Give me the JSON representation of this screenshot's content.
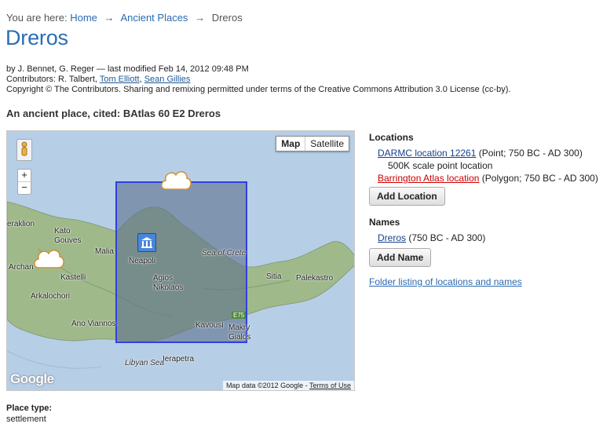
{
  "breadcrumb": {
    "prefix": "You are here:",
    "items": [
      "Home",
      "Ancient Places",
      "Dreros"
    ]
  },
  "page_title": "Dreros",
  "meta": {
    "byline": "by J. Bennet, G. Reger — last modified Feb 14, 2012 09:48 PM",
    "contributors_prefix": "Contributors: R. Talbert,",
    "contributor_links": [
      "Tom Elliott",
      "Sean Gillies"
    ],
    "copyright": "Copyright © The Contributors. Sharing and remixing permitted under terms of the Creative Commons Attribution 3.0 License (cc-by)."
  },
  "subtitle": "An ancient place, cited: BAtlas 60 E2 Dreros",
  "map": {
    "type_buttons": [
      "Map",
      "Satellite"
    ],
    "zoom_in": "+",
    "zoom_out": "−",
    "labels": {
      "heraklion": "eraklion",
      "kato_gouves": "Kato\nGouves",
      "malia": "Malia",
      "neapoli": "Neapoli",
      "sea_of_crete": "Sea of Crete",
      "archan": "Archan",
      "kastelli": "Kastelli",
      "agios_nikolaos": "Agios\nNikolaos",
      "sitia": "Sitia",
      "palekastro": "Palekastro",
      "arkalochori": "Arkalochori",
      "kavousi": "Kavousi",
      "e75": "E75",
      "ano_viannos": "Ano Viannos",
      "makry_gialos": "Makry\nGialos",
      "ierapetra": "Ierapetra",
      "libyan_sea": "Libyan Sea"
    },
    "google_logo": "Google",
    "attribution": "Map data ©2012 Google -",
    "terms": "Terms of Use"
  },
  "locations": {
    "heading": "Locations",
    "items": [
      {
        "link": "DARMC location 12261",
        "detail": "(Point; 750 BC - AD 300)",
        "note": "500K scale point location"
      },
      {
        "link": "Barrington Atlas location",
        "detail": "(Polygon; 750 BC - AD 300)"
      }
    ],
    "add_button": "Add Location"
  },
  "names": {
    "heading": "Names",
    "items": [
      {
        "link": "Dreros",
        "detail": "(750 BC - AD 300)"
      }
    ],
    "add_button": "Add Name"
  },
  "folder_link": "Folder listing of locations and names",
  "place_type": {
    "label": "Place type:",
    "value": "settlement"
  },
  "colors": {
    "title": "#2b6db5",
    "link": "#17408b",
    "broken_link": "#cc0000",
    "polygon_border": "#2f3fe0",
    "sea": "#b6cee6",
    "land": "#9fb98a"
  }
}
